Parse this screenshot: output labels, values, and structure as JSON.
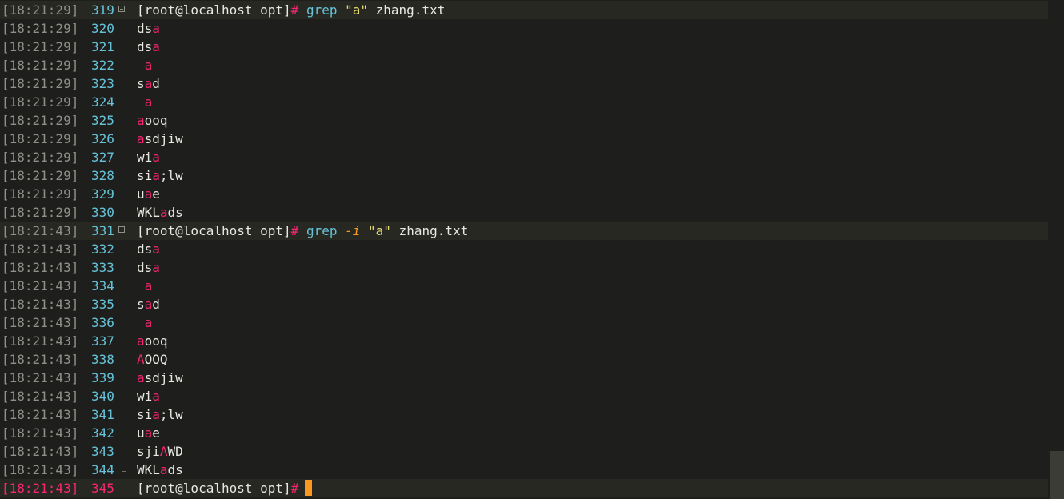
{
  "terminal": {
    "lines": [
      {
        "ts": "[18:21:29]",
        "ln": "319",
        "kind": "cmd",
        "fold": "start",
        "prompt": "[root@localhost opt]",
        "hash": "#",
        "cmd": [
          {
            "t": "grep",
            "c": "grep"
          },
          {
            "t": " ",
            "c": "plain"
          },
          {
            "t": "\"a\"",
            "c": "str"
          },
          {
            "t": " zhang.txt",
            "c": "plain"
          }
        ]
      },
      {
        "ts": "[18:21:29]",
        "ln": "320",
        "kind": "out",
        "fold": "mid",
        "parts": [
          {
            "t": "ds"
          },
          {
            "t": "a",
            "m": true
          }
        ]
      },
      {
        "ts": "[18:21:29]",
        "ln": "321",
        "kind": "out",
        "fold": "mid",
        "parts": [
          {
            "t": "ds"
          },
          {
            "t": "a",
            "m": true
          }
        ]
      },
      {
        "ts": "[18:21:29]",
        "ln": "322",
        "kind": "out",
        "fold": "mid",
        "parts": [
          {
            "t": " "
          },
          {
            "t": "a",
            "m": true
          }
        ]
      },
      {
        "ts": "[18:21:29]",
        "ln": "323",
        "kind": "out",
        "fold": "mid",
        "parts": [
          {
            "t": "s"
          },
          {
            "t": "a",
            "m": true
          },
          {
            "t": "d"
          }
        ]
      },
      {
        "ts": "[18:21:29]",
        "ln": "324",
        "kind": "out",
        "fold": "mid",
        "parts": [
          {
            "t": " "
          },
          {
            "t": "a",
            "m": true
          }
        ]
      },
      {
        "ts": "[18:21:29]",
        "ln": "325",
        "kind": "out",
        "fold": "mid",
        "parts": [
          {
            "t": "a",
            "m": true
          },
          {
            "t": "ooq"
          }
        ]
      },
      {
        "ts": "[18:21:29]",
        "ln": "326",
        "kind": "out",
        "fold": "mid",
        "parts": [
          {
            "t": "a",
            "m": true
          },
          {
            "t": "sdjiw"
          }
        ]
      },
      {
        "ts": "[18:21:29]",
        "ln": "327",
        "kind": "out",
        "fold": "mid",
        "parts": [
          {
            "t": "wi"
          },
          {
            "t": "a",
            "m": true
          }
        ]
      },
      {
        "ts": "[18:21:29]",
        "ln": "328",
        "kind": "out",
        "fold": "mid",
        "parts": [
          {
            "t": "si"
          },
          {
            "t": "a",
            "m": true
          },
          {
            "t": ";lw"
          }
        ]
      },
      {
        "ts": "[18:21:29]",
        "ln": "329",
        "kind": "out",
        "fold": "mid",
        "parts": [
          {
            "t": "u"
          },
          {
            "t": "a",
            "m": true
          },
          {
            "t": "e"
          }
        ]
      },
      {
        "ts": "[18:21:29]",
        "ln": "330",
        "kind": "out",
        "fold": "end",
        "parts": [
          {
            "t": "WKL"
          },
          {
            "t": "a",
            "m": true
          },
          {
            "t": "ds"
          }
        ]
      },
      {
        "ts": "[18:21:43]",
        "ln": "331",
        "kind": "cmd",
        "fold": "start",
        "prompt": "[root@localhost opt]",
        "hash": "#",
        "cmd": [
          {
            "t": "grep",
            "c": "grep"
          },
          {
            "t": " ",
            "c": "plain"
          },
          {
            "t": "-i",
            "c": "flag"
          },
          {
            "t": " ",
            "c": "plain"
          },
          {
            "t": "\"a\"",
            "c": "str"
          },
          {
            "t": " zhang.txt",
            "c": "plain"
          }
        ]
      },
      {
        "ts": "[18:21:43]",
        "ln": "332",
        "kind": "out",
        "fold": "mid",
        "parts": [
          {
            "t": "ds"
          },
          {
            "t": "a",
            "m": true
          }
        ]
      },
      {
        "ts": "[18:21:43]",
        "ln": "333",
        "kind": "out",
        "fold": "mid",
        "parts": [
          {
            "t": "ds"
          },
          {
            "t": "a",
            "m": true
          }
        ]
      },
      {
        "ts": "[18:21:43]",
        "ln": "334",
        "kind": "out",
        "fold": "mid",
        "parts": [
          {
            "t": " "
          },
          {
            "t": "a",
            "m": true
          }
        ]
      },
      {
        "ts": "[18:21:43]",
        "ln": "335",
        "kind": "out",
        "fold": "mid",
        "parts": [
          {
            "t": "s"
          },
          {
            "t": "a",
            "m": true
          },
          {
            "t": "d"
          }
        ]
      },
      {
        "ts": "[18:21:43]",
        "ln": "336",
        "kind": "out",
        "fold": "mid",
        "parts": [
          {
            "t": " "
          },
          {
            "t": "a",
            "m": true
          }
        ]
      },
      {
        "ts": "[18:21:43]",
        "ln": "337",
        "kind": "out",
        "fold": "mid",
        "parts": [
          {
            "t": "a",
            "m": true
          },
          {
            "t": "ooq"
          }
        ]
      },
      {
        "ts": "[18:21:43]",
        "ln": "338",
        "kind": "out",
        "fold": "mid",
        "parts": [
          {
            "t": "A",
            "m": true
          },
          {
            "t": "OOQ"
          }
        ]
      },
      {
        "ts": "[18:21:43]",
        "ln": "339",
        "kind": "out",
        "fold": "mid",
        "parts": [
          {
            "t": "a",
            "m": true
          },
          {
            "t": "sdjiw"
          }
        ]
      },
      {
        "ts": "[18:21:43]",
        "ln": "340",
        "kind": "out",
        "fold": "mid",
        "parts": [
          {
            "t": "wi"
          },
          {
            "t": "a",
            "m": true
          }
        ]
      },
      {
        "ts": "[18:21:43]",
        "ln": "341",
        "kind": "out",
        "fold": "mid",
        "parts": [
          {
            "t": "si"
          },
          {
            "t": "a",
            "m": true
          },
          {
            "t": ";lw"
          }
        ]
      },
      {
        "ts": "[18:21:43]",
        "ln": "342",
        "kind": "out",
        "fold": "mid",
        "parts": [
          {
            "t": "u"
          },
          {
            "t": "a",
            "m": true
          },
          {
            "t": "e"
          }
        ]
      },
      {
        "ts": "[18:21:43]",
        "ln": "343",
        "kind": "out",
        "fold": "mid",
        "parts": [
          {
            "t": "sji"
          },
          {
            "t": "A",
            "m": true
          },
          {
            "t": "WD"
          }
        ]
      },
      {
        "ts": "[18:21:43]",
        "ln": "344",
        "kind": "out",
        "fold": "end",
        "parts": [
          {
            "t": "WKL"
          },
          {
            "t": "a",
            "m": true
          },
          {
            "t": "ds"
          }
        ]
      },
      {
        "ts": "[18:21:43]",
        "ln": "345",
        "kind": "prompt",
        "fold": "none",
        "prompt": "[root@localhost opt]",
        "hash": "#",
        "current": true
      }
    ]
  },
  "colors": {
    "background": "#1e1f1c",
    "match": "#f92672",
    "command": "#66c2d9",
    "string": "#e6db74",
    "flag": "#fd971f",
    "cursor": "#fd971f"
  }
}
